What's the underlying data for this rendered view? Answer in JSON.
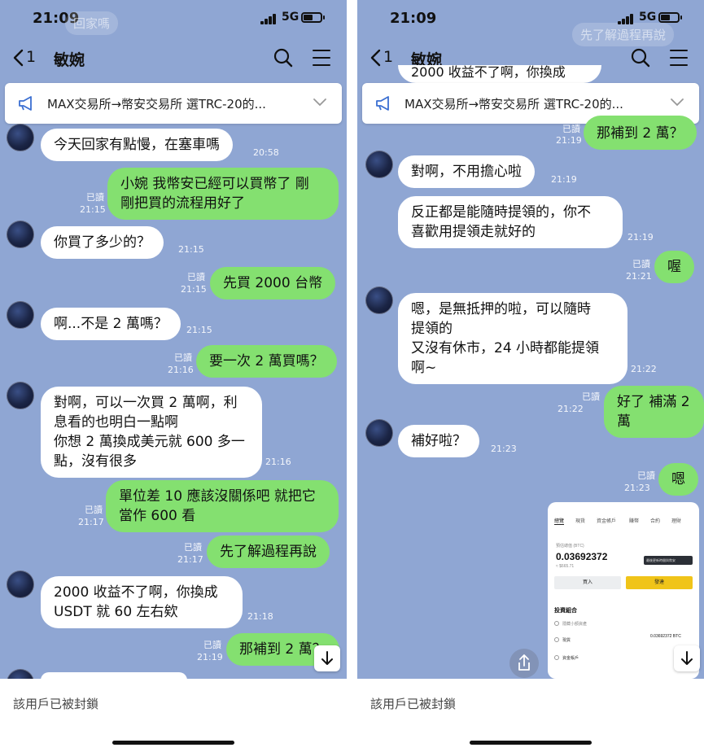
{
  "status": {
    "time": "21:09",
    "network": "5G"
  },
  "nav": {
    "back_count": "1",
    "title": "敏婉"
  },
  "announcement": {
    "text": "MAX交易所→幣安交易所 選TRC-20的..."
  },
  "labels": {
    "read": "已讀"
  },
  "footer": {
    "blocked_text": "該用戶已被封鎖"
  },
  "left": {
    "ghost_top": "回家嗎",
    "messages": [
      {
        "side": "in",
        "text": "今天回家有點慢，在塞車嗎",
        "time": "20:58"
      },
      {
        "side": "out",
        "text": "小婉 我幣安已經可以買幣了 剛\n剛把買的流程用好了",
        "time": "21:15",
        "read": true
      },
      {
        "side": "in",
        "text": "你買了多少的？",
        "time": "21:15"
      },
      {
        "side": "out",
        "text": "先買 2000 台幣",
        "time": "21:15",
        "read": true
      },
      {
        "side": "in",
        "text": "啊...不是 2 萬嗎？",
        "time": "21:15"
      },
      {
        "side": "out",
        "text": "要一次 2 萬買嗎？",
        "time": "21:16",
        "read": true
      },
      {
        "side": "in",
        "text": "對啊，可以一次買 2 萬啊，利\n息看的也明白一點啊\n你想 2 萬換成美元就 600 多一\n點，沒有很多",
        "time": "21:16"
      },
      {
        "side": "out",
        "text": "單位差 10 應該沒關係吧 就把它\n當作 600 看",
        "time": "21:17",
        "read": true
      },
      {
        "side": "out",
        "text": "先了解過程再說",
        "time": "21:17",
        "read": true
      },
      {
        "side": "in",
        "text": "2000 收益不了啊，你換成\nUSDT 就 60 左右欸",
        "time": "21:18"
      },
      {
        "side": "out",
        "text": "那補到 2 萬？",
        "time": "21:19",
        "read": true
      }
    ]
  },
  "right": {
    "ghost_top": "先了解過程再說",
    "partial_top": "2000 收益不了啊，你換成",
    "messages": [
      {
        "side": "out",
        "text": "那補到 2 萬？",
        "time": "21:19",
        "read": true
      },
      {
        "side": "in",
        "text": "對啊，不用擔心啦",
        "time": "21:19"
      },
      {
        "side": "in",
        "text": "反正都是能隨時提領的，你不\n喜歡用提領走就好的",
        "time": "21:19"
      },
      {
        "side": "out",
        "text": "喔",
        "time": "21:21",
        "read": true
      },
      {
        "side": "in",
        "text": "嗯，是無抵押的啦，可以隨時\n提領的\n又沒有休市，24 小時都能提領\n啊~",
        "time": "21:22"
      },
      {
        "side": "out",
        "text": "好了 補滿 2 萬",
        "time": "21:22",
        "read": true
      },
      {
        "side": "in",
        "text": "補好啦？",
        "time": "21:23"
      },
      {
        "side": "out",
        "text": "嗯",
        "time": "21:23",
        "read": true
      }
    ]
  },
  "screenshot_card": {
    "tabs": [
      "總覽",
      "現貨",
      "資金帳戶",
      "賺幣",
      "合約",
      "理財"
    ],
    "estimated_label": "預估總值 (BTC)",
    "balance": "0.03692372",
    "fiat": "≈ $665.71",
    "tooltip": "最後更新時間與幣安",
    "deposit_label": "買入",
    "withdraw_label": "發達",
    "portfolio_title": "投資組合",
    "hide_small": "隱藏小額資產",
    "rows": [
      {
        "label": "現貨",
        "value": "0.03692372 BTC"
      },
      {
        "label": "資金帳戶",
        "value": ""
      }
    ]
  }
}
